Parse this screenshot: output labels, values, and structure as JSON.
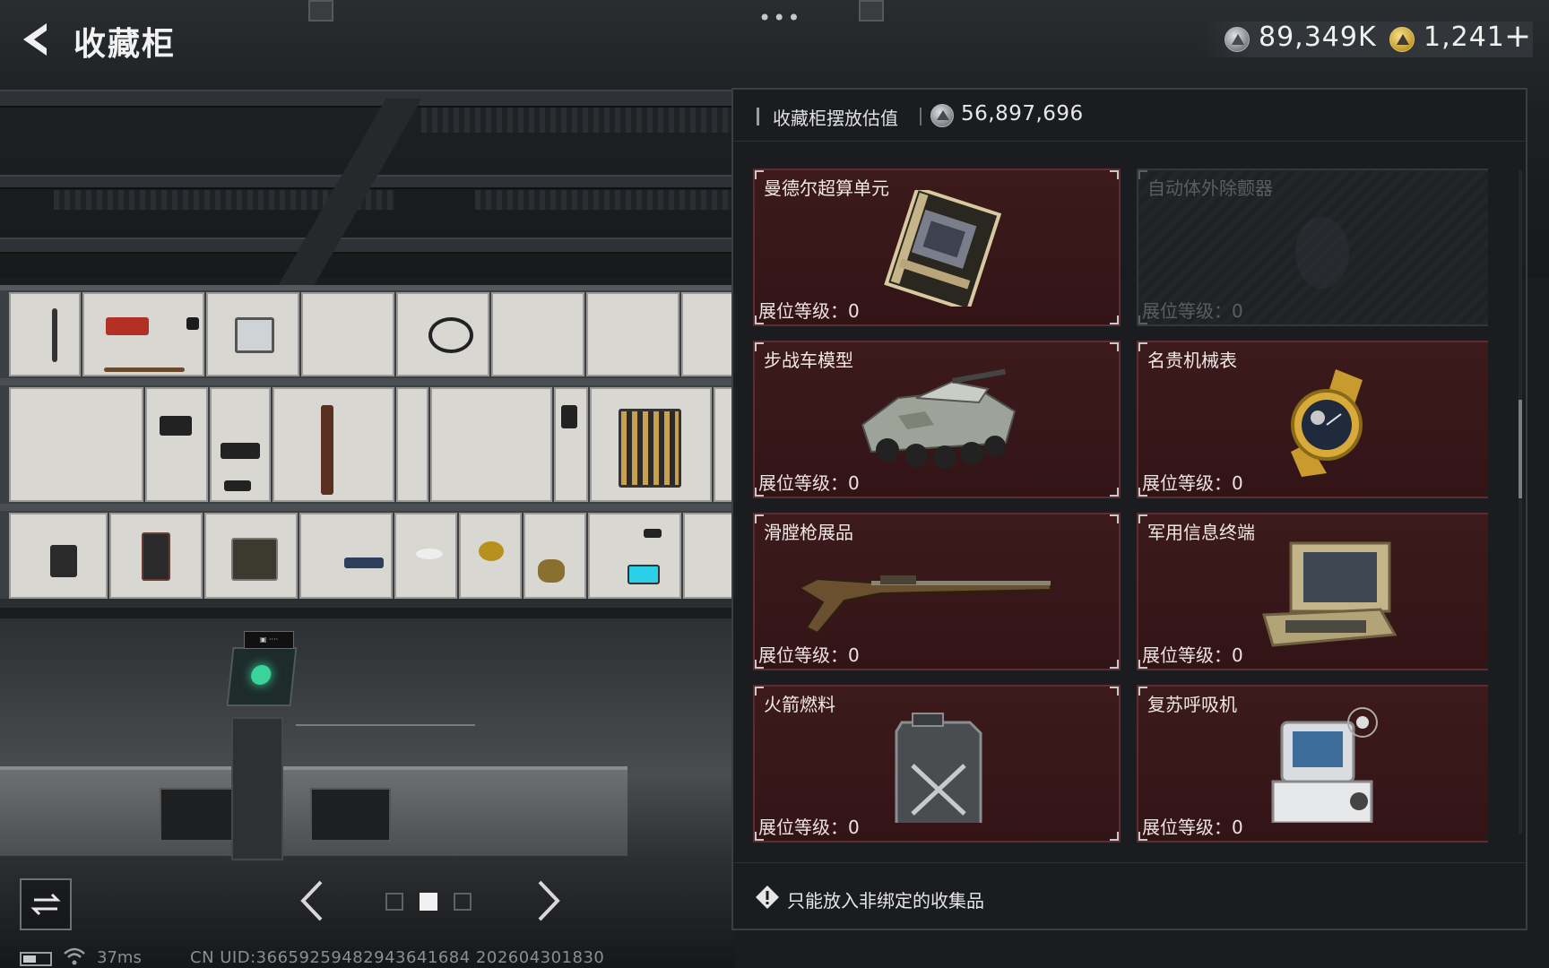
{
  "header": {
    "title": "收藏柜",
    "more_dots": "•••"
  },
  "currency": {
    "silver_amount": "89,349K",
    "gold_amount": "1,241",
    "add_label": "+"
  },
  "panel": {
    "value_label": "收藏柜摆放估值",
    "value_amount": "56,897,696",
    "items": [
      {
        "name": "曼德尔超算单元",
        "level_label": "展位等级：",
        "level": "0",
        "unlocked": true,
        "icon": "supercomputer-unit-icon"
      },
      {
        "name": "自动体外除颤器",
        "level_label": "展位等级：",
        "level": "0",
        "unlocked": false,
        "icon": "defibrillator-icon"
      },
      {
        "name": "步战车模型",
        "level_label": "展位等级：",
        "level": "0",
        "unlocked": true,
        "icon": "ifv-model-icon"
      },
      {
        "name": "名贵机械表",
        "level_label": "展位等级：",
        "level": "0",
        "unlocked": true,
        "icon": "mechanical-watch-icon"
      },
      {
        "name": "滑膛枪展品",
        "level_label": "展位等级：",
        "level": "0",
        "unlocked": true,
        "icon": "musket-icon"
      },
      {
        "name": "军用信息终端",
        "level_label": "展位等级：",
        "level": "0",
        "unlocked": true,
        "icon": "military-terminal-icon"
      },
      {
        "name": "火箭燃料",
        "level_label": "展位等级：",
        "level": "0",
        "unlocked": true,
        "icon": "fuel-jerrycan-icon"
      },
      {
        "name": "复苏呼吸机",
        "level_label": "展位等级：",
        "level": "0",
        "unlocked": true,
        "icon": "ventilator-icon"
      }
    ],
    "footer_note": "只能放入非绑定的收集品"
  },
  "pager": {
    "current_page": 2,
    "total_pages": 3
  },
  "status": {
    "ping": "37ms",
    "uid": "CN UID:36659259482943641684 202604301830"
  },
  "colors": {
    "card_bg": "#3c1a1c",
    "card_border": "#5c2d30",
    "panel_bg": "#1a1c1f"
  }
}
